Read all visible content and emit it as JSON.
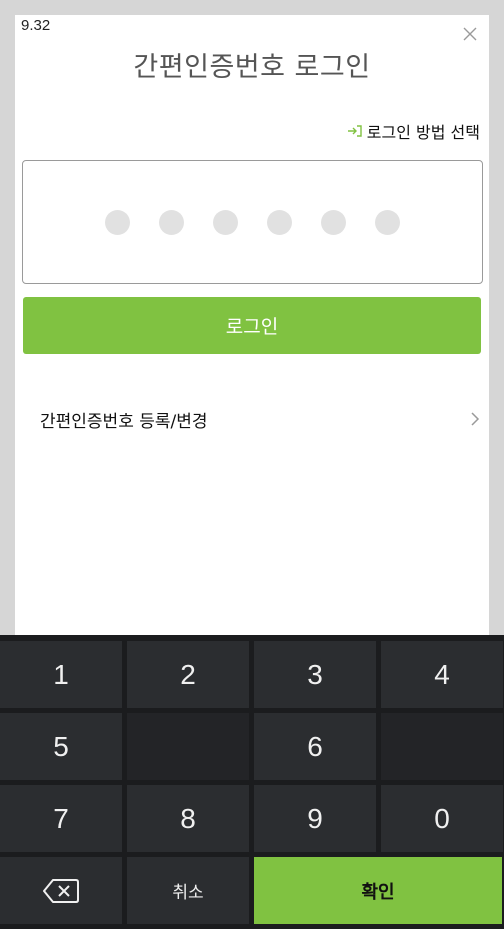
{
  "dialog": {
    "version": "9.32",
    "title": "간편인증번호 로그인",
    "method_label": "로그인 방법 선택",
    "pin_length": 6,
    "login_label": "로그인",
    "register_label": "간편인증번호 등록/변경"
  },
  "keypad": {
    "row1": [
      "1",
      "2",
      "3",
      "4"
    ],
    "row2": [
      "5",
      "",
      "6",
      ""
    ],
    "row3": [
      "7",
      "8",
      "9",
      "0"
    ],
    "cancel_label": "취소",
    "confirm_label": "확인"
  },
  "colors": {
    "accent": "#80c241",
    "keypad_bg": "#1b1c1e",
    "key_bg": "#2b2d30"
  }
}
